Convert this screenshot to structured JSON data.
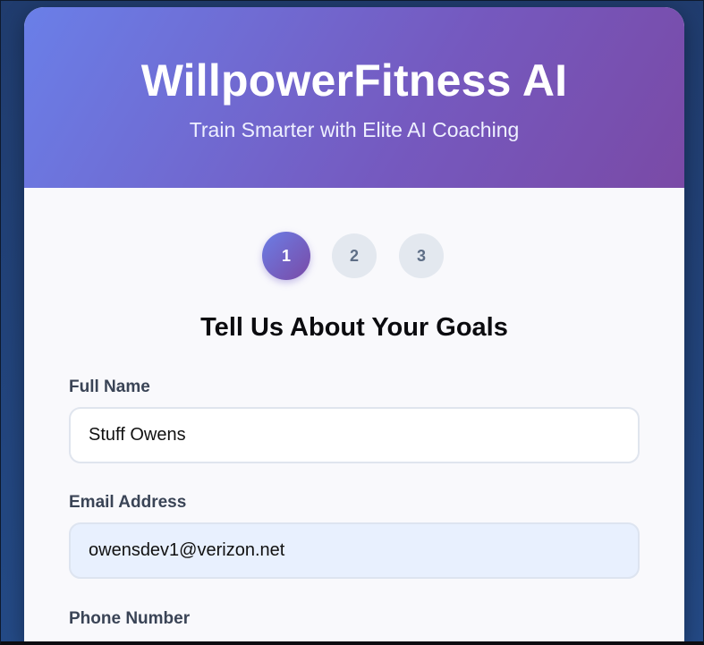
{
  "header": {
    "title": "WillpowerFitness AI",
    "subtitle": "Train Smarter with Elite AI Coaching"
  },
  "steps": [
    {
      "number": "1",
      "active": true
    },
    {
      "number": "2",
      "active": false
    },
    {
      "number": "3",
      "active": false
    }
  ],
  "form": {
    "section_title": "Tell Us About Your Goals",
    "full_name": {
      "label": "Full Name",
      "value": "Stuff Owens"
    },
    "email": {
      "label": "Email Address",
      "value": "owensdev1@verizon.net"
    },
    "phone": {
      "label": "Phone Number"
    }
  },
  "colors": {
    "header_gradient_start": "#6a7fe8",
    "header_gradient_end": "#7a4aa6",
    "page_background": "#244a86",
    "inactive_step": "#e3e8ef",
    "autofill_background": "#e8f0fe"
  }
}
